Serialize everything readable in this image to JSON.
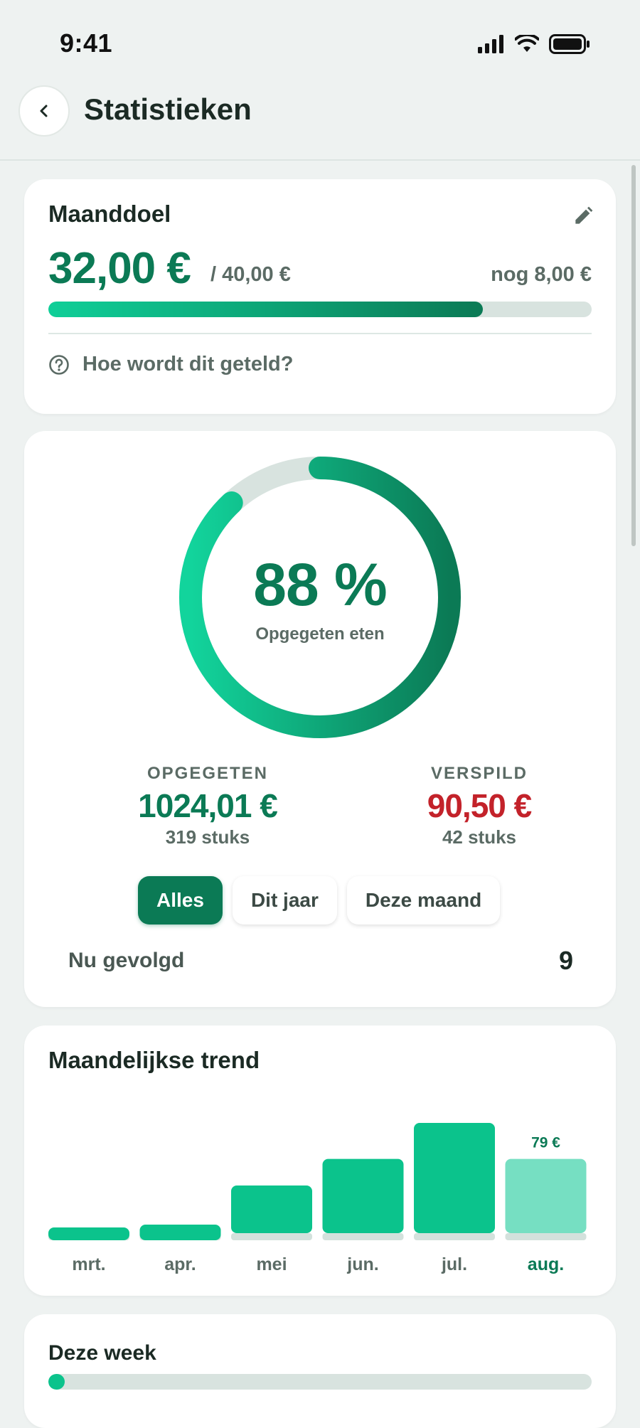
{
  "status_bar": {
    "time": "9:41",
    "icons": [
      "signal-icon",
      "wifi-icon",
      "battery-icon"
    ]
  },
  "header": {
    "title": "Statistieken",
    "back_icon": "chevron-left-icon"
  },
  "goal": {
    "title": "Maanddoel",
    "amount": "32,00 €",
    "target": "/ 40,00 €",
    "remaining": "nog 8,00 €",
    "progress": 0.8,
    "help_label": "Hoe wordt dit geteld?",
    "edit_icon": "pencil-icon",
    "help_icon": "question-circle-icon"
  },
  "summary": {
    "percent_value": 88,
    "percent_text": "88 %",
    "percent_label": "Opgegeten eten",
    "eaten": {
      "label": "OPGEGETEN",
      "value": "1024,01 €",
      "count": "319 stuks"
    },
    "wasted": {
      "label": "VERSPILD",
      "value": "90,50 €",
      "count": "42 stuks"
    },
    "filters": [
      {
        "label": "Alles",
        "active": true
      },
      {
        "label": "Dit jaar",
        "active": false
      },
      {
        "label": "Deze maand",
        "active": false
      }
    ],
    "tracked_label": "Nu gevolgd",
    "tracked_value": "9"
  },
  "trend": {
    "title": "Maandelijkse trend",
    "highlight_label": "79 €",
    "colors": {
      "bar": "#0bc38c",
      "bar_current": "#76dfc2",
      "base": "#d3e1dc",
      "label_current": "#0b7a55"
    },
    "chart_data": {
      "type": "bar",
      "categories": [
        "mrt.",
        "apr.",
        "mei",
        "jun.",
        "jul.",
        "aug."
      ],
      "values": [
        8,
        10,
        35,
        52,
        75,
        52
      ],
      "highlight_index": 5
    }
  },
  "week": {
    "title": "Deze week",
    "progress": 0.03
  },
  "colors": {
    "accent": "#0b7a55",
    "accent_light": "#0fcf98",
    "danger": "#c3222a",
    "track": "#d8e3df"
  }
}
